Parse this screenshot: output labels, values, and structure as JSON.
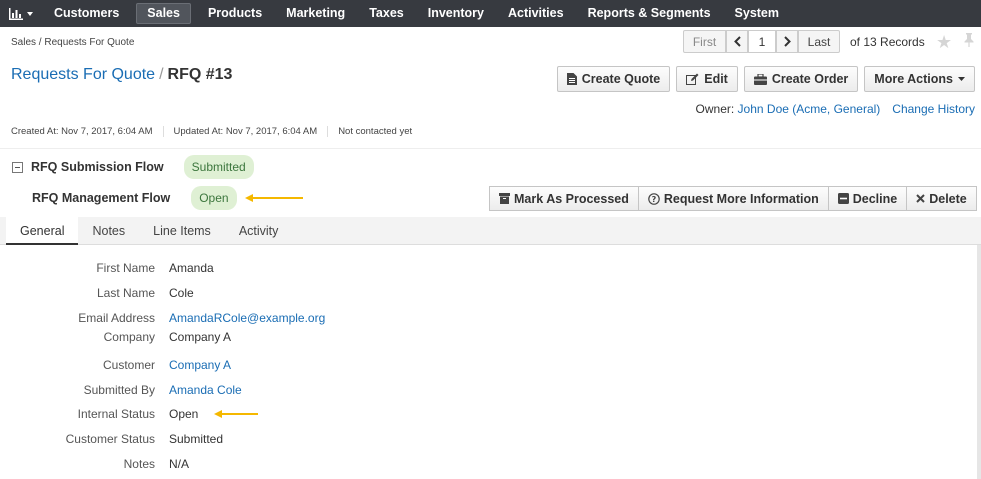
{
  "nav": {
    "logo_icon": "bar-chart-icon",
    "items": [
      "Customers",
      "Sales",
      "Products",
      "Marketing",
      "Taxes",
      "Inventory",
      "Activities",
      "Reports & Segments",
      "System"
    ],
    "active": "Sales"
  },
  "breadcrumb": "Sales / Requests For Quote",
  "pager": {
    "first": "First",
    "page": "1",
    "last": "Last",
    "count": "of 13 Records"
  },
  "title": {
    "parent": "Requests For Quote",
    "separator": "/",
    "current": "RFQ #13"
  },
  "actions": {
    "create_quote": "Create Quote",
    "edit": "Edit",
    "create_order": "Create Order",
    "more_actions": "More Actions"
  },
  "owner": {
    "label": "Owner:",
    "name": "John Doe (Acme, General)",
    "change_history": "Change History"
  },
  "meta": {
    "created": "Created At: Nov 7, 2017, 6:04 AM",
    "updated": "Updated At: Nov 7, 2017, 6:04 AM",
    "contact": "Not contacted yet"
  },
  "workflows": {
    "submission": {
      "label": "RFQ Submission Flow",
      "status": "Submitted"
    },
    "management": {
      "label": "RFQ Management Flow",
      "status": "Open"
    }
  },
  "workflow_actions": {
    "mark_processed": "Mark As Processed",
    "request_info": "Request More Information",
    "decline": "Decline",
    "delete": "Delete"
  },
  "tabs": [
    "General",
    "Notes",
    "Line Items",
    "Activity"
  ],
  "fields": {
    "first_name": {
      "label": "First Name",
      "value": "Amanda"
    },
    "last_name": {
      "label": "Last Name",
      "value": "Cole"
    },
    "email": {
      "label": "Email Address",
      "value": "AmandaRCole@example.org"
    },
    "company": {
      "label": "Company",
      "value": "Company A"
    },
    "customer": {
      "label": "Customer",
      "value": "Company A"
    },
    "submitted_by": {
      "label": "Submitted By",
      "value": "Amanda Cole"
    },
    "internal_status": {
      "label": "Internal Status",
      "value": "Open"
    },
    "customer_status": {
      "label": "Customer Status",
      "value": "Submitted"
    },
    "notes": {
      "label": "Notes",
      "value": "N/A"
    }
  },
  "colors": {
    "nav_bg": "#373a40",
    "link": "#1a6db4",
    "badge_bg": "#dff0d4",
    "badge_text": "#3c763d",
    "arrow": "#f5b800"
  }
}
